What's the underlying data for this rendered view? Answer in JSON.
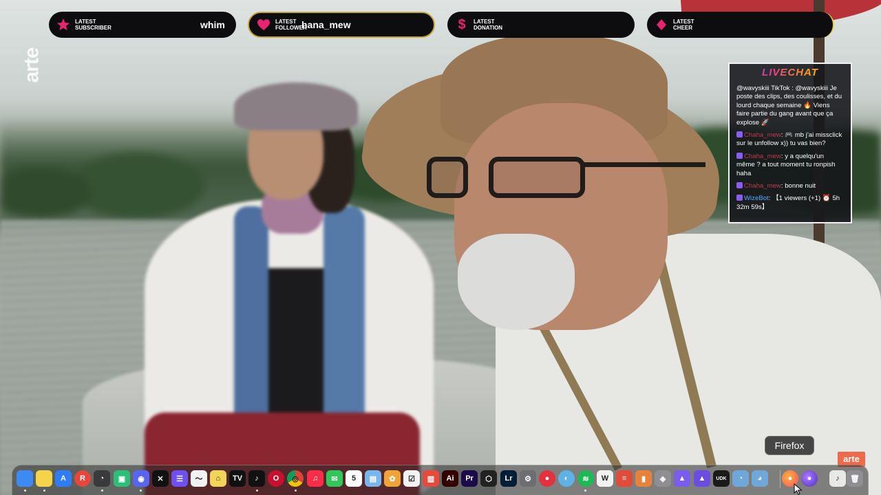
{
  "watermark": {
    "vertical": "arte",
    "corner": "arte"
  },
  "alerts": [
    {
      "id": "subscriber",
      "label_line1": "LATEST",
      "label_line2": "SUBSCRIBER",
      "value": "whim",
      "icon": "star-icon",
      "icon_color": "#e6246f"
    },
    {
      "id": "follower",
      "label_line1": "LATEST",
      "label_line2": "FOLLOWER",
      "value": "hana_mew",
      "icon": "heart-icon",
      "icon_color": "#e6246f"
    },
    {
      "id": "donation",
      "label_line1": "LATEST",
      "label_line2": "DONATION",
      "value": "",
      "icon": "dollar-icon",
      "icon_color": "#e6246f"
    },
    {
      "id": "cheer",
      "label_line1": "LATEST",
      "label_line2": "CHEER",
      "value": "",
      "icon": "diamond-icon",
      "icon_color": "#e6246f"
    }
  ],
  "chat": {
    "title": "LIVECHAT",
    "messages": [
      {
        "user": "@wavyskiii",
        "text": "  TikTok : @wavyskiii Je poste des clips, des coulisses, et du lourd chaque semaine 🔥 Viens faire partie du gang avant que ça explose 🚀"
      },
      {
        "user": "Chaha_mew",
        "text": ": 🎮 mb j'ai missclick sur le unfollow x)) tu vas bien?"
      },
      {
        "user": "Chaha_mew",
        "text": ": y a quelqu'un même ? a tout moment tu ronpish haha"
      },
      {
        "user": "Chaha_mew",
        "text": ": bonne nuit"
      },
      {
        "user": "WizeBot",
        "text": ": 【1 viewers (+1) ⏰ 5h 32m 59s】"
      }
    ]
  },
  "dock": {
    "tooltip": "Firefox",
    "colors": {
      "accent": "#e6246f",
      "chat_name": "#c0394f",
      "bot_name": "#5aa8ff"
    },
    "apps": [
      {
        "name": "Finder",
        "icon": "finder-icon",
        "label": "",
        "color": "#3d8bf2",
        "dot": true
      },
      {
        "name": "Notes",
        "icon": "notes-icon",
        "label": "",
        "color": "#f5d34a",
        "dot": true
      },
      {
        "name": "App Store",
        "icon": "appstore-icon",
        "label": "A",
        "color": "#2e7cf6",
        "dot": false
      },
      {
        "name": "Reeder",
        "icon": "reeder-icon",
        "label": "R",
        "color": "#e6473c",
        "dot": false
      },
      {
        "name": "Activity",
        "icon": "activity-icon",
        "label": "◔",
        "color": "#3a3a3c",
        "dot": true
      },
      {
        "name": "Android",
        "icon": "android-icon",
        "label": "▣",
        "color": "#2dbf7a",
        "dot": false
      },
      {
        "name": "Discord",
        "icon": "discord-icon",
        "label": "◉",
        "color": "#5865f2",
        "dot": true
      },
      {
        "name": "CapCut",
        "icon": "capcut-icon",
        "label": "✕",
        "color": "#111111",
        "dot": false
      },
      {
        "name": "Menu",
        "icon": "menu-icon",
        "label": "☰",
        "color": "#6e4ff0",
        "dot": false
      },
      {
        "name": "Freeform",
        "icon": "freeform-icon",
        "label": "〜",
        "color": "#f2f2f2",
        "dot": false
      },
      {
        "name": "Home",
        "icon": "home-icon",
        "label": "⌂",
        "color": "#f2d45a",
        "dot": false
      },
      {
        "name": "TV",
        "icon": "tv-icon",
        "label": "TV",
        "color": "#111111",
        "dot": false
      },
      {
        "name": "TikTok",
        "icon": "tiktok-icon",
        "label": "♪",
        "color": "#111111",
        "dot": true
      },
      {
        "name": "Opera",
        "icon": "opera-icon",
        "label": "O",
        "color": "#c8102e",
        "dot": false
      },
      {
        "name": "Chrome",
        "icon": "chrome-icon",
        "label": "◎",
        "color": "#f4c20d",
        "dot": true
      },
      {
        "name": "Music",
        "icon": "music-icon",
        "label": "♫",
        "color": "#fa2d48",
        "dot": false
      },
      {
        "name": "Messages",
        "icon": "messages-icon",
        "label": "✉",
        "color": "#31c759",
        "dot": false
      },
      {
        "name": "Calendar",
        "icon": "calendar-icon",
        "label": "5",
        "color": "#ffffff",
        "dot": false
      },
      {
        "name": "Preview",
        "icon": "preview-icon",
        "label": "▤",
        "color": "#7ab6ee",
        "dot": false
      },
      {
        "name": "Photos",
        "icon": "photos-icon",
        "label": "✿",
        "color": "#f0a33b",
        "dot": false
      },
      {
        "name": "Reminders",
        "icon": "reminders-icon",
        "label": "☑",
        "color": "#f2f2f2",
        "dot": false
      },
      {
        "name": "Ticket",
        "icon": "ticket-icon",
        "label": "▥",
        "color": "#e64a3c",
        "dot": false
      },
      {
        "name": "Illustrator",
        "icon": "illustrator-icon",
        "label": "Ai",
        "color": "#330000",
        "dot": false
      },
      {
        "name": "Premiere Pro",
        "icon": "premiere-icon",
        "label": "Pr",
        "color": "#1a0a4a",
        "dot": false
      },
      {
        "name": "Unity",
        "icon": "unity-icon",
        "label": "⬡",
        "color": "#222222",
        "dot": false
      },
      {
        "name": "Lightroom",
        "icon": "lightroom-icon",
        "label": "Lr",
        "color": "#001e36",
        "dot": false
      },
      {
        "name": "System Settings",
        "icon": "settings-icon",
        "label": "⚙",
        "color": "#6d6d72",
        "dot": false
      },
      {
        "name": "Record",
        "icon": "record-icon",
        "label": "●",
        "color": "#e2313f",
        "dot": false
      },
      {
        "name": "Browser",
        "icon": "browser-icon",
        "label": "◐",
        "color": "#5fb2e6",
        "dot": false
      },
      {
        "name": "Spotify",
        "icon": "spotify-icon",
        "label": "≋",
        "color": "#1db954",
        "dot": true
      },
      {
        "name": "Waves",
        "icon": "waves-icon",
        "label": "W",
        "color": "#f2f2f2",
        "dot": false
      },
      {
        "name": "Stack",
        "icon": "stack-icon",
        "label": "≡",
        "color": "#e24b3a",
        "dot": false
      },
      {
        "name": "Logic",
        "icon": "logic-icon",
        "label": "▮",
        "color": "#e8813a",
        "dot": false
      },
      {
        "name": "Controller",
        "icon": "controller-icon",
        "label": "◈",
        "color": "#8e8e93",
        "dot": false
      },
      {
        "name": "Affinity",
        "icon": "affinity-icon",
        "label": "▲",
        "color": "#7b5cf0",
        "dot": false
      },
      {
        "name": "Affinity 2",
        "icon": "affinity2-icon",
        "label": "▲",
        "color": "#6b4de0",
        "dot": false
      },
      {
        "name": "UDK",
        "icon": "udk-icon",
        "label": "UDK",
        "color": "#1a1a1a",
        "dot": false
      },
      {
        "name": "Meter",
        "icon": "meter-icon",
        "label": "◔",
        "color": "#6fa8d8",
        "dot": false
      },
      {
        "name": "Meter 2",
        "icon": "meter2-icon",
        "label": "◕",
        "color": "#6fa8d8",
        "dot": false
      },
      {
        "name": "Firefox",
        "icon": "firefox-icon",
        "label": "●",
        "color": "#ff7139",
        "dot": false
      },
      {
        "name": "Firefox Dev",
        "icon": "firefox-dev-icon",
        "label": "●",
        "color": "#7a3cf0",
        "dot": false
      },
      {
        "name": "Music File",
        "icon": "music-file-icon",
        "label": "♪",
        "color": "#e8e8e8",
        "dot": false
      },
      {
        "name": "Trash",
        "icon": "trash-icon",
        "label": "🗑",
        "color": "#8e8e93",
        "dot": false
      }
    ]
  }
}
